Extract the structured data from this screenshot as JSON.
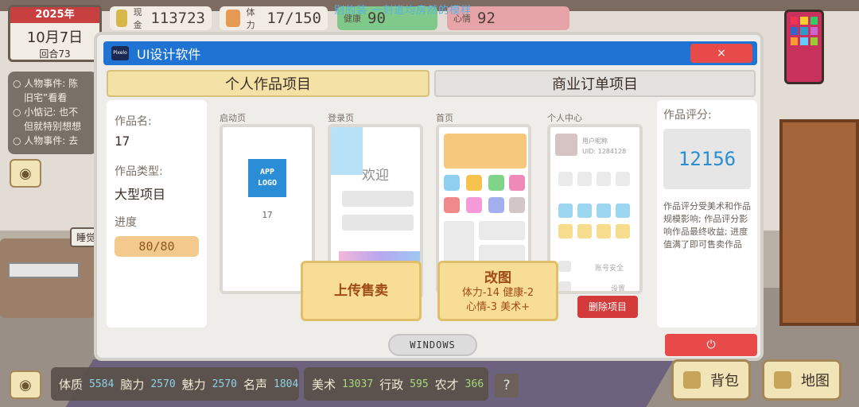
{
  "hud": {
    "year": "2025年",
    "month_day": "10月7日",
    "round": "回合73",
    "money_label": "现金",
    "money": "113723",
    "stamina_label": "体力",
    "stamina": "17/150",
    "health_label": "健康",
    "health": "90",
    "mood_label": "心情",
    "mood": "92",
    "top_banner": "别的装 一刻道均房然的模样"
  },
  "events": {
    "e1": "人物事件: 陈",
    "e1b": "旧宅”看看",
    "e2": "小惦记: 也不",
    "e2b": "但就特别想想",
    "e3": "人物事件: 去"
  },
  "scene": {
    "sleep_tag": "睡觉"
  },
  "dialog": {
    "title": "UI设计软件",
    "app_icon_text": "Pixelo",
    "close_icon": "×",
    "tab_personal": "个人作品项目",
    "tab_business": "商业订单项目",
    "work_name_label": "作品名:",
    "work_name": "17",
    "work_type_label": "作品类型:",
    "work_type": "大型项目",
    "progress_label": "进度",
    "progress": "80/80",
    "screens": {
      "splash": "启动页",
      "login": "登录页",
      "home": "首页",
      "profile": "个人中心"
    },
    "app_logo": "APP LOGO",
    "splash_caption": "17",
    "welcome": "欢迎",
    "nickname": "用户昵称",
    "uid": "UID: 1284128",
    "account_security": "账号安全",
    "settings": "设置",
    "upload_btn": "上传售卖",
    "redraw_title": "改图",
    "redraw_cost_1": "体力-14 健康-2",
    "redraw_cost_2": "心情-3 美术+",
    "delete_btn": "删除项目",
    "score_label": "作品评分:",
    "score": "12156",
    "score_desc": "作品评分受美术和作品规模影响; 作品评分影响作品最终收益; 进度值满了即可售卖作品",
    "windows_btn": "WINDOWS",
    "power_icon": "⏻"
  },
  "stats": {
    "physique_label": "体质",
    "physique": "5584",
    "brain_label": "脑力",
    "brain": "2570",
    "charm_label": "魅力",
    "charm": "2570",
    "fame_label": "名声",
    "fame": "1804",
    "art_label": "美术",
    "art": "13037",
    "admin_label": "行政",
    "admin": "595",
    "farm_label": "农才",
    "farm": "366",
    "help": "?"
  },
  "buttons": {
    "bag": "背包",
    "map": "地图",
    "eye": "◉"
  },
  "colors": {
    "accent_blue": "#1f73d2",
    "close_red": "#e84a4a",
    "tab_gold": "#f3e1a6",
    "score_blue": "#2a8ed6"
  }
}
